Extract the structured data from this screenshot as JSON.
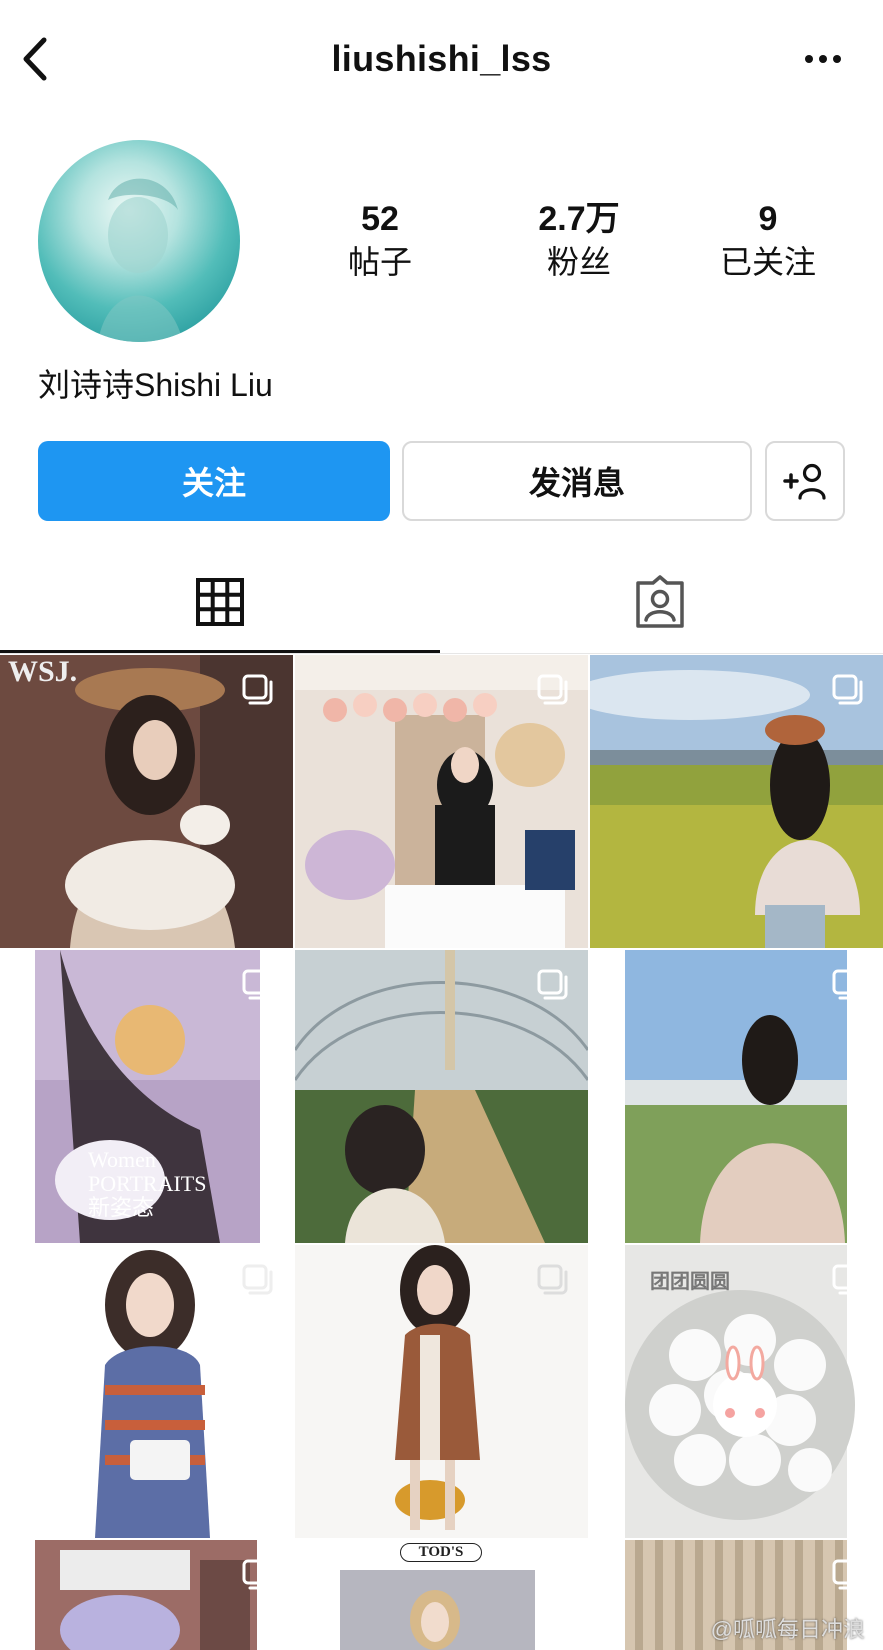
{
  "header": {
    "username": "liushishi_lss",
    "back_icon": "chevron-left-icon",
    "more_icon": "more-horizontal-icon"
  },
  "profile": {
    "display_name": "刘诗诗Shishi Liu",
    "stats": [
      {
        "value": "52",
        "label": "帖子"
      },
      {
        "value": "2.7万",
        "label": "粉丝"
      },
      {
        "value": "9",
        "label": "已关注"
      }
    ]
  },
  "actions": {
    "follow_label": "关注",
    "message_label": "发消息",
    "add_person_icon": "add-person-icon",
    "follow_color": "#1e96f2"
  },
  "tabs": [
    {
      "icon": "grid-icon",
      "active": true
    },
    {
      "icon": "tagged-person-icon",
      "active": false
    }
  ],
  "posts": [
    {
      "description": "magazine-cover-with-lamb",
      "text": "WSJ."
    },
    {
      "description": "birthday-party",
      "text": ""
    },
    {
      "description": "field-with-orange-hat",
      "text": ""
    },
    {
      "description": "elle-cover-flower",
      "text": "Women PORTRAITS 新姿态"
    },
    {
      "description": "greenhouse",
      "text": ""
    },
    {
      "description": "village-field",
      "text": ""
    },
    {
      "description": "striped-dress",
      "text": ""
    },
    {
      "description": "brown-dress-bag",
      "text": ""
    },
    {
      "description": "rice-balls-bowl",
      "text": "团团圆圆"
    },
    {
      "description": "bedroom",
      "text": ""
    },
    {
      "description": "tods-model",
      "text": "TOD'S"
    },
    {
      "description": "striped-curtain",
      "text": ""
    }
  ],
  "watermark": "@呱呱每日冲浪"
}
